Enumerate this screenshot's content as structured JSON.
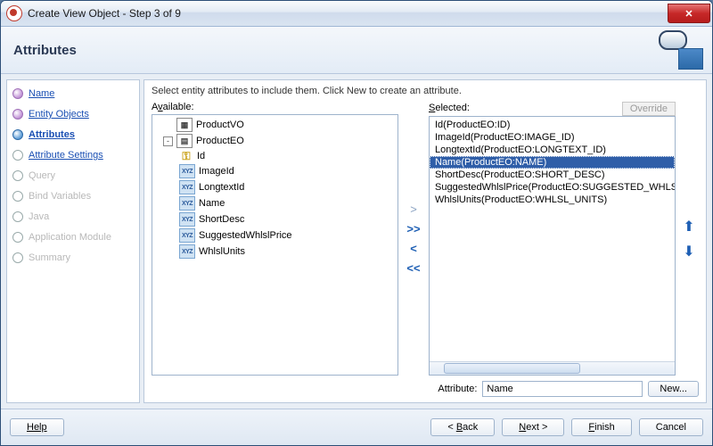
{
  "window": {
    "title": "Create View Object - Step 3 of 9"
  },
  "header": {
    "title": "Attributes"
  },
  "nav": {
    "items": [
      {
        "label": "Name",
        "state": "done"
      },
      {
        "label": "Entity Objects",
        "state": "done"
      },
      {
        "label": "Attributes",
        "state": "current"
      },
      {
        "label": "Attribute Settings",
        "state": "enabled"
      },
      {
        "label": "Query",
        "state": "disabled"
      },
      {
        "label": "Bind Variables",
        "state": "disabled"
      },
      {
        "label": "Java",
        "state": "disabled"
      },
      {
        "label": "Application Module",
        "state": "disabled"
      },
      {
        "label": "Summary",
        "state": "disabled"
      }
    ]
  },
  "main": {
    "instruction": "Select entity attributes to include them.  Click New to create an attribute.",
    "available_label_html": "A<span class=\"u\">v</span>ailable:",
    "selected_label_html": "<span class=\"u\">S</span>elected:",
    "override_label": "Override",
    "available_tree": [
      {
        "depth": 0,
        "icon": "vo",
        "label": "ProductVO",
        "expander": null
      },
      {
        "depth": 0,
        "icon": "eo",
        "label": "ProductEO",
        "expander": "-"
      },
      {
        "depth": 1,
        "icon": "key",
        "label": "Id"
      },
      {
        "depth": 1,
        "icon": "xyz",
        "label": "ImageId"
      },
      {
        "depth": 1,
        "icon": "xyz",
        "label": "LongtextId"
      },
      {
        "depth": 1,
        "icon": "xyz",
        "label": "Name"
      },
      {
        "depth": 1,
        "icon": "xyz",
        "label": "ShortDesc"
      },
      {
        "depth": 1,
        "icon": "xyz",
        "label": "SuggestedWhlslPrice"
      },
      {
        "depth": 1,
        "icon": "xyz",
        "label": "WhlslUnits"
      }
    ],
    "selected_list": [
      {
        "label": "Id(ProductEO:ID)"
      },
      {
        "label": "ImageId(ProductEO:IMAGE_ID)"
      },
      {
        "label": "LongtextId(ProductEO:LONGTEXT_ID)"
      },
      {
        "label": "Name(ProductEO:NAME)",
        "selected": true
      },
      {
        "label": "ShortDesc(ProductEO:SHORT_DESC)"
      },
      {
        "label": "SuggestedWhlslPrice(ProductEO:SUGGESTED_WHLSL_PRICE)"
      },
      {
        "label": "WhlslUnits(ProductEO:WHLSL_UNITS)"
      }
    ],
    "attribute_label": "Attribute:",
    "attribute_value": "Name",
    "new_button": "New..."
  },
  "footer": {
    "help": "Help",
    "back": "< Back",
    "next": "Next >",
    "finish": "Finish",
    "cancel": "Cancel"
  }
}
